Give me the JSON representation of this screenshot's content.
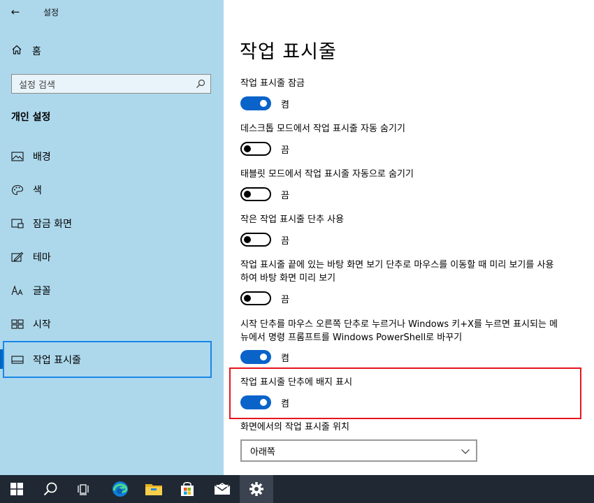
{
  "window": {
    "title": "설정",
    "back_glyph": "←"
  },
  "sidebar": {
    "home_label": "홈",
    "search_placeholder": "설정 검색",
    "section_title": "개인 설정",
    "items": [
      {
        "label": "배경",
        "icon": "picture-icon"
      },
      {
        "label": "색",
        "icon": "palette-icon"
      },
      {
        "label": "잠금 화면",
        "icon": "lock-screen-icon"
      },
      {
        "label": "테마",
        "icon": "theme-icon"
      },
      {
        "label": "글꼴",
        "icon": "font-icon"
      },
      {
        "label": "시작",
        "icon": "start-icon"
      },
      {
        "label": "작업 표시줄",
        "icon": "taskbar-icon",
        "selected": true
      }
    ]
  },
  "main": {
    "title": "작업 표시줄",
    "settings": [
      {
        "label": "작업 표시줄 잠금",
        "state": "켬",
        "on": true
      },
      {
        "label": "데스크톱 모드에서 작업 표시줄 자동 숨기기",
        "state": "끔",
        "on": false
      },
      {
        "label": "태블릿 모드에서 작업 표시줄 자동으로 숨기기",
        "state": "끔",
        "on": false
      },
      {
        "label": "작은 작업 표시줄 단추 사용",
        "state": "끔",
        "on": false
      },
      {
        "label": "작업 표시줄 끝에 있는 바탕 화면 보기 단추로 마우스를 이동할 때 미리 보기를 사용하여 바탕 화면 미리 보기",
        "state": "끔",
        "on": false
      },
      {
        "label": "시작 단추를 마우스 오른쪽 단추로 누르거나 Windows 키+X를 누르면 표시되는 메뉴에서 명령 프롬프트를 Windows PowerShell로 바꾸기",
        "state": "켬",
        "on": true
      },
      {
        "label": "작업 표시줄 단추에 배지 표시",
        "state": "켬",
        "on": true
      }
    ],
    "position": {
      "label": "화면에서의 작업 표시줄 위치",
      "value": "아래쪽"
    }
  },
  "colors": {
    "accent": "#0a63c9",
    "sidebar_bg": "#add8ec",
    "taskbar_bg": "#1f2833",
    "highlight": "#e8141c"
  },
  "taskbar": {
    "icons": [
      "windows-start-icon",
      "search-icon",
      "task-view-icon",
      "edge-icon",
      "file-explorer-icon",
      "store-icon",
      "mail-icon",
      "settings-gear-icon"
    ]
  }
}
